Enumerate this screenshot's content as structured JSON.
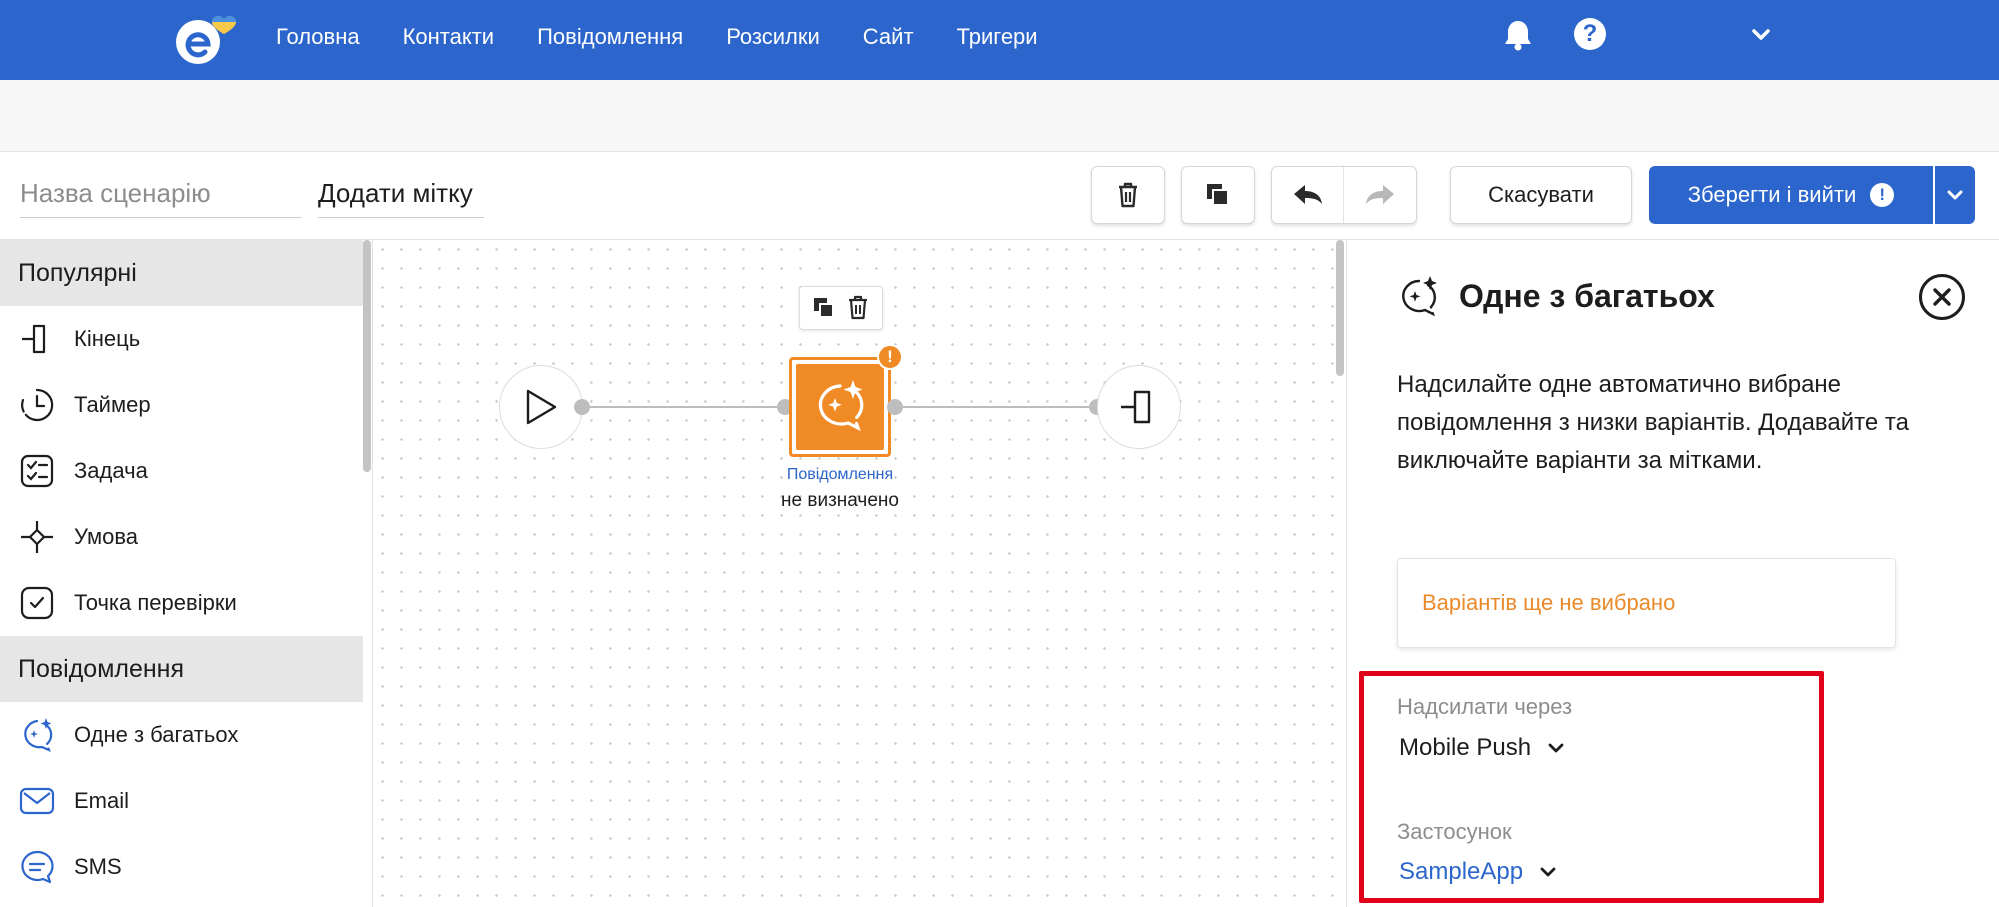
{
  "nav": {
    "items": [
      "Головна",
      "Контакти",
      "Повідомлення",
      "Розсилки",
      "Сайт",
      "Тригери"
    ]
  },
  "toolbar": {
    "scenario_name_placeholder": "Назва сценарію",
    "add_tag_label": "Додати мітку",
    "cancel_label": "Скасувати",
    "save_label": "Зберегти і вийти"
  },
  "sidebar": {
    "groups": [
      {
        "title": "Популярні",
        "items": [
          {
            "label": "Кінець",
            "icon": "exit-bracket-icon"
          },
          {
            "label": "Таймер",
            "icon": "timer-icon"
          },
          {
            "label": "Задача",
            "icon": "task-checklist-icon"
          },
          {
            "label": "Умова",
            "icon": "condition-diamond-icon"
          },
          {
            "label": "Точка перевірки",
            "icon": "checkpoint-icon"
          }
        ]
      },
      {
        "title": "Повідомлення",
        "items": [
          {
            "label": "Одне з багатьох",
            "icon": "sparkle-chat-icon"
          },
          {
            "label": "Email",
            "icon": "email-icon"
          },
          {
            "label": "SMS",
            "icon": "sms-icon"
          }
        ]
      }
    ]
  },
  "canvas": {
    "message_node": {
      "type_label": "Повідомлення",
      "value_label": "не визначено",
      "warning": "!"
    }
  },
  "panel": {
    "title": "Одне з багатьох",
    "description": "Надсилайте одне автоматично вибране повідомлення з низки варіантів. Додавайте та виключайте варіанти за мітками.",
    "variants_empty": "Варіантів ще не вибрано",
    "send_via_label": "Надсилати через",
    "send_via_value": "Mobile Push",
    "app_label": "Застосунок",
    "app_value": "SampleApp"
  },
  "colors": {
    "brand_blue": "#2c66cc",
    "accent_orange": "#f08a24",
    "highlight_red": "#e1001a"
  }
}
